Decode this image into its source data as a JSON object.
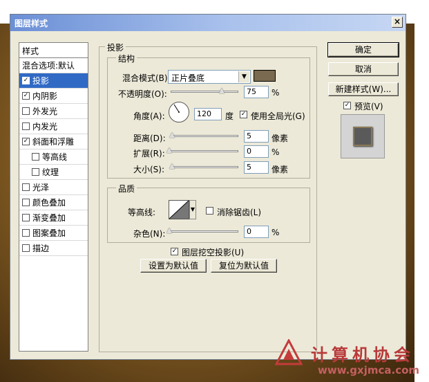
{
  "dialog": {
    "title": "图层样式",
    "close_label": "×"
  },
  "styles_list": {
    "header": "样式",
    "blend_options": "混合选项:默认",
    "items": [
      {
        "label": "投影",
        "checked": true,
        "selected": true,
        "indent": false
      },
      {
        "label": "内阴影",
        "checked": true,
        "selected": false,
        "indent": false
      },
      {
        "label": "外发光",
        "checked": false,
        "selected": false,
        "indent": false
      },
      {
        "label": "内发光",
        "checked": false,
        "selected": false,
        "indent": false
      },
      {
        "label": "斜面和浮雕",
        "checked": true,
        "selected": false,
        "indent": false
      },
      {
        "label": "等高线",
        "checked": false,
        "selected": false,
        "indent": true
      },
      {
        "label": "纹理",
        "checked": false,
        "selected": false,
        "indent": true
      },
      {
        "label": "光泽",
        "checked": false,
        "selected": false,
        "indent": false
      },
      {
        "label": "颜色叠加",
        "checked": false,
        "selected": false,
        "indent": false
      },
      {
        "label": "渐变叠加",
        "checked": false,
        "selected": false,
        "indent": false
      },
      {
        "label": "图案叠加",
        "checked": false,
        "selected": false,
        "indent": false
      },
      {
        "label": "描边",
        "checked": false,
        "selected": false,
        "indent": false
      }
    ]
  },
  "shadow": {
    "group_title": "投影",
    "structure": {
      "title": "结构",
      "blend_mode_label": "混合模式(B):",
      "blend_mode_value": "正片叠底",
      "shadow_color": "#7a6a50",
      "opacity_label": "不透明度(O):",
      "opacity_value": "75",
      "opacity_level": 0.75,
      "percent": "%",
      "angle_label": "角度(A):",
      "angle_value": "120",
      "degree_unit": "度",
      "global_light_label": "使用全局光(G)",
      "global_light_checked": true,
      "distance_label": "距离(D):",
      "distance_value": "5",
      "pixel_unit": "像素",
      "spread_label": "扩展(R):",
      "spread_value": "0",
      "size_label": "大小(S):",
      "size_value": "5"
    },
    "quality": {
      "title": "品质",
      "contour_label": "等高线:",
      "anti_alias_label": "消除锯齿(L)",
      "anti_alias_checked": false,
      "noise_label": "杂色(N):",
      "noise_value": "0",
      "percent": "%"
    },
    "knockout_label": "图层挖空投影(U)",
    "knockout_checked": true,
    "make_default_label": "设置为默认值",
    "reset_default_label": "复位为默认值"
  },
  "buttons": {
    "ok": "确定",
    "cancel": "取消",
    "new_style": "新建样式(W)...",
    "preview_label": "预览(V)",
    "preview_checked": true
  },
  "watermark": {
    "title": "计算机协会",
    "url": "www.gxjmca.com"
  }
}
